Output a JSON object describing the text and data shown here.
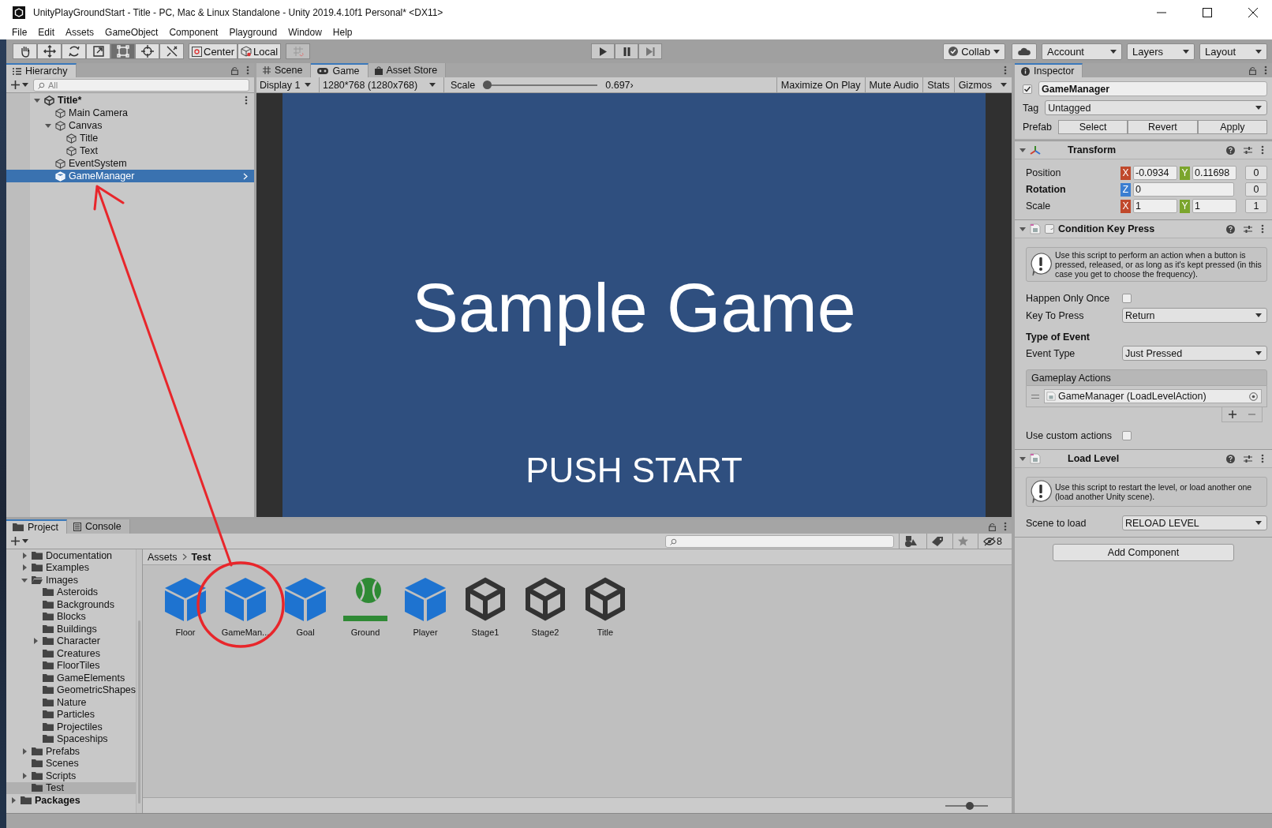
{
  "window": {
    "title": "UnityPlayGroundStart - Title - PC, Mac & Linux Standalone - Unity 2019.4.10f1 Personal* <DX11>"
  },
  "menu": [
    "File",
    "Edit",
    "Assets",
    "GameObject",
    "Component",
    "Playground",
    "Window",
    "Help"
  ],
  "toolbar": {
    "tools": [
      {
        "selected": false
      },
      {
        "selected": false
      },
      {
        "selected": false
      },
      {
        "selected": false
      },
      {
        "selected": true
      },
      {
        "selected": false
      },
      {
        "selected": false
      }
    ],
    "pivot": [
      "Center",
      "Local"
    ],
    "collab": "Collab",
    "account": "Account",
    "layers": "Layers",
    "layout": "Layout"
  },
  "hierarchy": {
    "tab": "Hierarchy",
    "search_placeholder": "All",
    "tree": [
      {
        "label": "Title*",
        "kind": "scene",
        "expanded": true,
        "selected": false,
        "children": [
          {
            "label": "Main Camera",
            "kind": "object",
            "selected": false
          },
          {
            "label": "Canvas",
            "kind": "object",
            "expanded": true,
            "selected": false,
            "children": [
              {
                "label": "Title",
                "kind": "object",
                "selected": false
              },
              {
                "label": "Text",
                "kind": "object",
                "selected": false
              }
            ]
          },
          {
            "label": "EventSystem",
            "kind": "object",
            "selected": false
          },
          {
            "label": "GameManager",
            "kind": "object",
            "selected": true
          }
        ]
      }
    ]
  },
  "game": {
    "tabs": [
      {
        "label": "Scene",
        "selected": false
      },
      {
        "label": "Game",
        "selected": true
      },
      {
        "label": "Asset Store",
        "selected": false
      }
    ],
    "display": "Display 1",
    "resolution": "1280*768 (1280x768)",
    "scale_label": "Scale",
    "scale": {
      "level": 0,
      "reading": "0.697›"
    },
    "buttons": [
      "Maximize On Play",
      "Mute Audio",
      "Stats",
      "Gizmos"
    ],
    "screen": {
      "title": "Sample Game",
      "prompt": "PUSH START"
    }
  },
  "inspector": {
    "tab": "Inspector",
    "object": {
      "active": true,
      "name": "GameManager"
    },
    "tag": {
      "label": "Tag",
      "value": "Untagged"
    },
    "prefab": {
      "label": "Prefab",
      "buttons": [
        "Select",
        "Revert",
        "Apply"
      ]
    },
    "components": [
      {
        "kind": "transform",
        "title": "Transform",
        "expanded": true,
        "rows": [
          {
            "label": "Position",
            "bold": false,
            "fields": [
              {
                "axis": "X",
                "color": "#c0492c",
                "value": "-0.0934"
              },
              {
                "axis": "Y",
                "color": "#7ba52c",
                "value": "0.11698"
              }
            ],
            "extra": "0"
          },
          {
            "label": "Rotation",
            "bold": true,
            "fields": [
              {
                "axis": "Z",
                "color": "#3b7ed1",
                "value": "0"
              }
            ],
            "extra": "0"
          },
          {
            "label": "Scale",
            "bold": false,
            "fields": [
              {
                "axis": "X",
                "color": "#c0492c",
                "value": "1"
              },
              {
                "axis": "Y",
                "color": "#7ba52c",
                "value": "1"
              }
            ],
            "extra": "1"
          }
        ]
      },
      {
        "kind": "script",
        "title": "Condition Key Press",
        "enabled": true,
        "expanded": true,
        "rows": [
          {
            "kind": "help",
            "text": "Use this script to perform an action when a button is pressed, released, or as long as it's kept pressed (in this case you get to choose the frequency)."
          },
          {
            "kind": "toggle",
            "label": "Happen Only Once",
            "checked": false
          },
          {
            "kind": "dropdown",
            "label": "Key To Press",
            "value": "Return"
          },
          {
            "kind": "heading",
            "label": "Type of Event"
          },
          {
            "kind": "dropdown",
            "label": "Event Type",
            "value": "Just Pressed"
          },
          {
            "kind": "actions",
            "title": "Gameplay Actions",
            "items": [
              "GameManager (LoadLevelAction)"
            ]
          },
          {
            "kind": "toggle",
            "label": "Use custom actions",
            "checked": false
          }
        ]
      },
      {
        "kind": "script",
        "title": "Load Level",
        "expanded": true,
        "rows": [
          {
            "kind": "help",
            "text": "Use this script to restart the level, or load another one (load another Unity scene)."
          },
          {
            "kind": "dropdown",
            "label": "Scene to load",
            "value": "RELOAD LEVEL"
          }
        ]
      }
    ],
    "add_button": "Add Component"
  },
  "project": {
    "tabs": [
      {
        "label": "Project",
        "selected": true
      },
      {
        "label": "Console",
        "selected": false
      }
    ],
    "hidden_count": "8",
    "folders": [
      {
        "label": "Documentation",
        "expanded": false,
        "selected": false
      },
      {
        "label": "Examples",
        "expanded": false,
        "selected": false
      },
      {
        "label": "Images",
        "expanded": true,
        "selected": false,
        "children": [
          {
            "label": "Asteroids",
            "selected": false
          },
          {
            "label": "Backgrounds",
            "selected": false
          },
          {
            "label": "Blocks",
            "selected": false
          },
          {
            "label": "Buildings",
            "selected": false
          },
          {
            "label": "Character",
            "expanded": false,
            "selected": false
          },
          {
            "label": "Creatures",
            "selected": false
          },
          {
            "label": "FloorTiles",
            "selected": false
          },
          {
            "label": "GameElements",
            "selected": false
          },
          {
            "label": "GeometricShapes",
            "selected": false
          },
          {
            "label": "Nature",
            "selected": false
          },
          {
            "label": "Particles",
            "selected": false
          },
          {
            "label": "Projectiles",
            "selected": false
          },
          {
            "label": "Spaceships",
            "selected": false
          }
        ]
      },
      {
        "label": "Prefabs",
        "expanded": false,
        "selected": false
      },
      {
        "label": "Scenes",
        "selected": false
      },
      {
        "label": "Scripts",
        "expanded": false,
        "selected": false
      },
      {
        "label": "Test",
        "selected": true
      }
    ],
    "packages": {
      "label": "Packages",
      "expanded": false,
      "selected": false
    },
    "breadcrumb": [
      "Assets",
      "Test"
    ],
    "assets": [
      {
        "label": "Floor",
        "kind": "prefab"
      },
      {
        "label": "GameMan...",
        "kind": "prefab"
      },
      {
        "label": "Goal",
        "kind": "prefab"
      },
      {
        "label": "Ground",
        "kind": "tile"
      },
      {
        "label": "Player",
        "kind": "prefab"
      },
      {
        "label": "Stage1",
        "kind": "scene"
      },
      {
        "label": "Stage2",
        "kind": "scene"
      },
      {
        "label": "Title",
        "kind": "scene"
      }
    ],
    "zoom": {
      "level": 0.58
    }
  }
}
